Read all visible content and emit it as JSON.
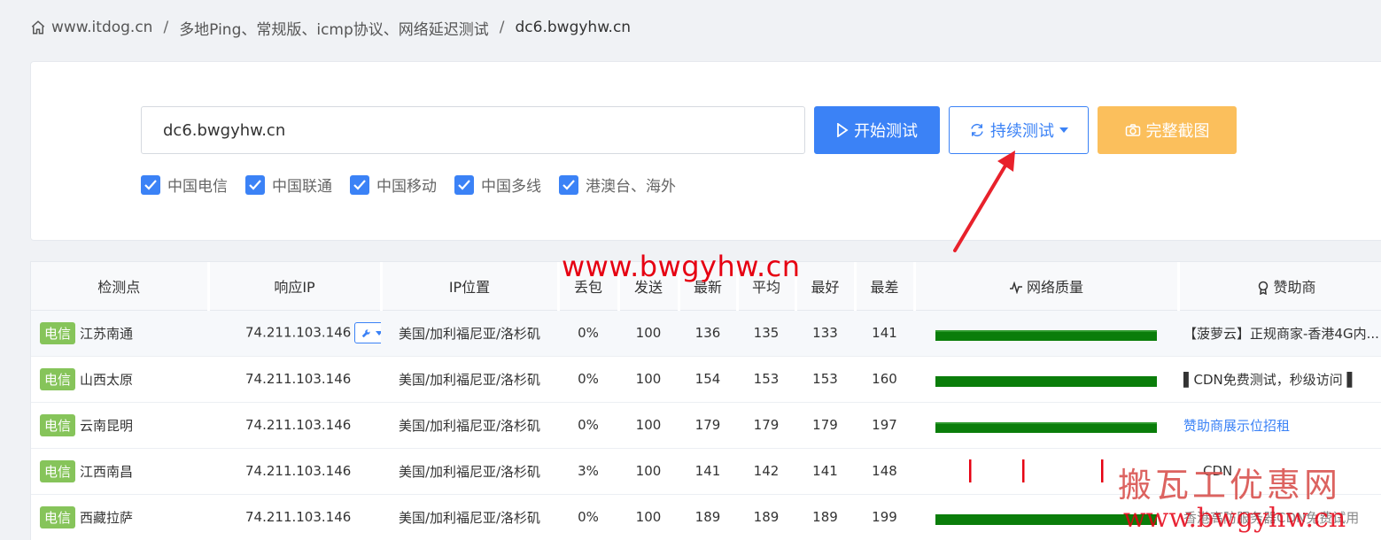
{
  "breadcrumb": {
    "home": "www.itdog.cn",
    "section": "多地Ping、常规版、icmp协议、网络延迟测试",
    "current": "dc6.bwgyhw.cn"
  },
  "search": {
    "value": "dc6.bwgyhw.cn"
  },
  "buttons": {
    "start": "开始测试",
    "loop": "持续测试",
    "screenshot": "完整截图"
  },
  "filters": [
    {
      "label": "中国电信",
      "checked": true
    },
    {
      "label": "中国联通",
      "checked": true
    },
    {
      "label": "中国移动",
      "checked": true
    },
    {
      "label": "中国多线",
      "checked": true
    },
    {
      "label": "港澳台、海外",
      "checked": true
    }
  ],
  "table": {
    "headers": {
      "node": "检测点",
      "ip": "响应IP",
      "location": "IP位置",
      "loss": "丢包",
      "sent": "发送",
      "latest": "最新",
      "avg": "平均",
      "best": "最好",
      "worst": "最差",
      "quality": "网络质量",
      "sponsor": "赞助商"
    },
    "rows": [
      {
        "isp": "电信",
        "node": "江苏南通",
        "ip": "74.211.103.146",
        "location": "美国/加利福尼亚/洛杉矶",
        "loss": "0%",
        "sent": "100",
        "latest": "136",
        "avg": "135",
        "best": "133",
        "worst": "141",
        "sponsor": "【菠萝云】正规商家-香港4G内...",
        "sponsor_link": false
      },
      {
        "isp": "电信",
        "node": "山西太原",
        "ip": "74.211.103.146",
        "location": "美国/加利福尼亚/洛杉矶",
        "loss": "0%",
        "sent": "100",
        "latest": "154",
        "avg": "153",
        "best": "153",
        "worst": "160",
        "sponsor": "▌CDN免费测试，秒级访问 ▌",
        "sponsor_link": false
      },
      {
        "isp": "电信",
        "node": "云南昆明",
        "ip": "74.211.103.146",
        "location": "美国/加利福尼亚/洛杉矶",
        "loss": "0%",
        "sent": "100",
        "latest": "179",
        "avg": "179",
        "best": "179",
        "worst": "197",
        "sponsor": "赞助商展示位招租",
        "sponsor_link": true
      },
      {
        "isp": "电信",
        "node": "江西南昌",
        "ip": "74.211.103.146",
        "location": "美国/加利福尼亚/洛杉矶",
        "loss": "3%",
        "sent": "100",
        "latest": "141",
        "avg": "142",
        "best": "141",
        "worst": "148",
        "sponsor": "CDN",
        "sponsor_link": false
      },
      {
        "isp": "电信",
        "node": "西藏拉萨",
        "ip": "74.211.103.146",
        "location": "美国/加利福尼亚/洛杉矶",
        "loss": "0%",
        "sent": "100",
        "latest": "189",
        "avg": "189",
        "best": "189",
        "worst": "199",
        "sponsor": "香港高防服务器CDN免费试用",
        "sponsor_link": false
      }
    ]
  },
  "watermarks": {
    "url": "www.bwgyhw.cn",
    "cn": "搬瓦工优惠网",
    "url2": "www.bwgyhw.cn"
  },
  "colors": {
    "primary": "#3b82f6",
    "warning": "#fbbf5c",
    "badge": "#86c45a",
    "quality_ok": "#0a7d0a",
    "quality_loss": "#e60012",
    "watermark": "#e60012"
  }
}
